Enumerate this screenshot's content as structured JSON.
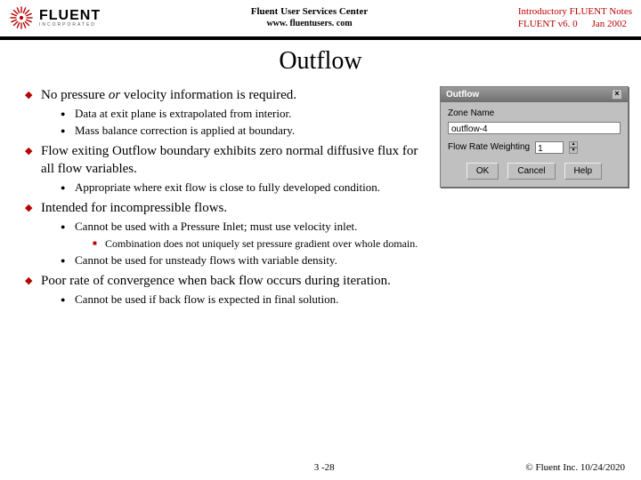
{
  "header": {
    "logo_name": "FLUENT",
    "logo_sub": "INCORPORATED",
    "center_line1": "Fluent User Services Center",
    "center_line2": "www. fluentusers. com",
    "right_line1": "Introductory FLUENT Notes",
    "right_line2a": "FLUENT v6. 0",
    "right_line2b": "Jan 2002"
  },
  "title": "Outflow",
  "bullets": [
    {
      "text_pre": "No pressure ",
      "text_em": "or",
      "text_post": " velocity information is required.",
      "wrap": true,
      "sub": [
        {
          "text": "Data at exit plane is extrapolated from interior.",
          "wrap": true
        },
        {
          "text": "Mass balance correction is applied at boundary.",
          "wrap": true
        }
      ]
    },
    {
      "text": "Flow exiting Outflow boundary exhibits zero normal diffusive flux for all flow variables.",
      "wrap": true,
      "sub": [
        {
          "text": "Appropriate where exit flow is close to fully developed condition.",
          "wrap": true
        }
      ]
    },
    {
      "text": "Intended for incompressible flows.",
      "sub": [
        {
          "text": "Cannot be used with a Pressure Inlet; must use velocity inlet.",
          "sub": [
            {
              "text": "Combination does not uniquely set pressure gradient over whole domain."
            }
          ]
        },
        {
          "text": "Cannot be used for unsteady flows with variable density."
        }
      ]
    },
    {
      "text": "Poor rate of convergence when back flow occurs during iteration.",
      "sub": [
        {
          "text": "Cannot be used if back flow is expected in final solution."
        }
      ]
    }
  ],
  "dialog": {
    "title": "Outflow",
    "zone_label": "Zone Name",
    "zone_value": "outflow-4",
    "flow_label": "Flow Rate Weighting",
    "flow_value": "1",
    "btn_ok": "OK",
    "btn_cancel": "Cancel",
    "btn_help": "Help"
  },
  "footer": {
    "page": "3 -28",
    "copyright": "© Fluent Inc. 10/24/2020"
  }
}
